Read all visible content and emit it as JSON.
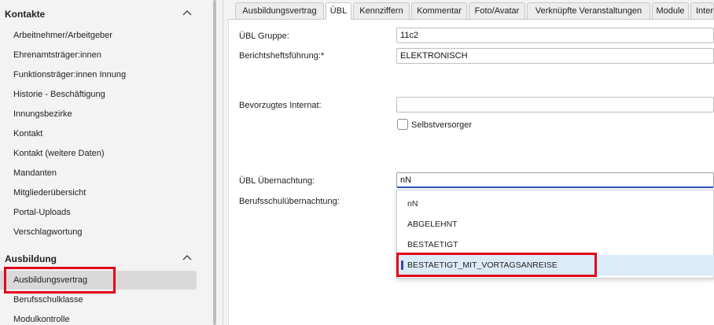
{
  "sidebar": {
    "sections": [
      {
        "title": "Kontakte",
        "items": [
          {
            "label": "Arbeitnehmer/Arbeitgeber"
          },
          {
            "label": "Ehrenamtsträger:innen"
          },
          {
            "label": "Funktionsträger:innen Innung"
          },
          {
            "label": "Historie - Beschäftigung"
          },
          {
            "label": "Innungsbezirke"
          },
          {
            "label": "Kontakt"
          },
          {
            "label": "Kontakt (weitere Daten)"
          },
          {
            "label": "Mandanten"
          },
          {
            "label": "Mitgliederübersicht"
          },
          {
            "label": "Portal-Uploads"
          },
          {
            "label": "Verschlagwortung"
          }
        ]
      },
      {
        "title": "Ausbildung",
        "items": [
          {
            "label": "Ausbildungsvertrag",
            "selected": true
          },
          {
            "label": "Berufsschulklasse"
          },
          {
            "label": "Modulkontrolle"
          }
        ]
      }
    ],
    "collapse_icon": "chevron-up-icon"
  },
  "tabs": [
    {
      "label": "Ausbildungsvertrag"
    },
    {
      "label": "ÜBL",
      "active": true
    },
    {
      "label": "Kennziffern"
    },
    {
      "label": "Kommentar"
    },
    {
      "label": "Foto/Avatar"
    },
    {
      "label": "Verknüpfte Veranstaltungen"
    },
    {
      "label": "Module"
    },
    {
      "label": "Inter"
    }
  ],
  "form": {
    "ubl_gruppe": {
      "label": "ÜBL Gruppe:",
      "value": "11c2"
    },
    "berichtsheft": {
      "label": "Berichtsheftsführung:*",
      "value": "ELEKTRONISCH"
    },
    "internat": {
      "label": "Bevorzugtes Internat:",
      "value": ""
    },
    "selbstversorger": {
      "label": "Selbstversorger",
      "checked": false
    },
    "uebernachtung": {
      "label": "ÜBL Übernachtung:",
      "value": "nN"
    },
    "berufsschul": {
      "label": "Berufsschulübernachtung:"
    }
  },
  "dropdown": {
    "options": [
      {
        "label": "nN"
      },
      {
        "label": "ABGELEHNT"
      },
      {
        "label": "BESTAETIGT"
      },
      {
        "label": "BESTAETIGT_MIT_VORTAGSANREISE",
        "selected": true
      }
    ]
  },
  "colors": {
    "highlight": "#e3001b",
    "accent": "#3a47b6",
    "selected_option_bg": "#dcebf8"
  }
}
